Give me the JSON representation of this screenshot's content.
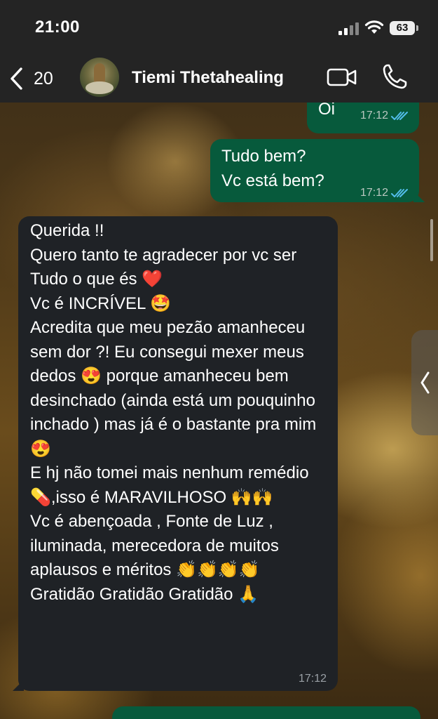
{
  "status_bar": {
    "time": "21:00",
    "battery": "63"
  },
  "header": {
    "back_count": "20",
    "contact_name": "Tiemi Thetahealing"
  },
  "messages": [
    {
      "direction": "outgoing",
      "text": "Oi",
      "time": "17:12",
      "read": true
    },
    {
      "direction": "outgoing",
      "text": "Tudo bem?\nVc está bem?",
      "time": "17:12",
      "read": true
    },
    {
      "direction": "incoming",
      "text": "Querida !!\nQuero tanto te agradecer por vc ser Tudo o que és ❤️\nVc é INCRÍVEL 🤩\nAcredita que meu pezão amanheceu sem dor ?! Eu consegui mexer meus dedos 😍 porque amanheceu bem desinchado (ainda está um pouquinho inchado ) mas já é o bastante pra mim 😍\nE hj não tomei mais nenhum remédio 💊,isso é MARAVILHOSO 🙌🙌\nVc é abençoada , Fonte de Luz , iluminada, merecedora de muitos aplausos e méritos 👏👏👏👏\nGratidão Gratidão Gratidão 🙏",
      "time": "17:12"
    }
  ],
  "icons": {
    "back": "chevron-left-icon",
    "video": "video-camera-icon",
    "call": "phone-icon",
    "read_receipt": "double-check-icon",
    "side_panel": "chevron-left-icon"
  },
  "colors": {
    "outgoing_bubble": "#075a3c",
    "incoming_bubble": "#1f2226",
    "read_tick": "#53bdeb",
    "header_bg": "#242424"
  }
}
